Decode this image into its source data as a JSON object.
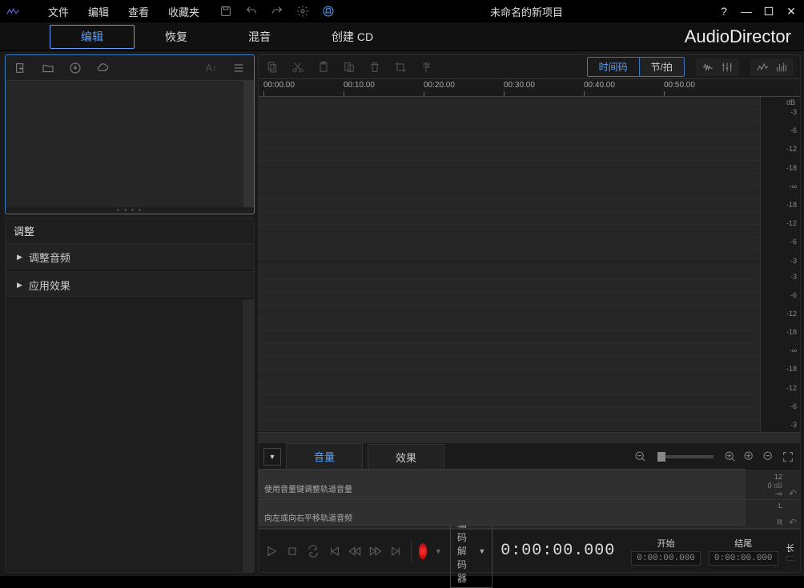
{
  "titlebar": {
    "menu": {
      "file": "文件",
      "edit": "编辑",
      "view": "查看",
      "favorites": "收藏夹"
    },
    "project_title": "未命名的新项目"
  },
  "brand": "AudioDirector",
  "mode_tabs": {
    "edit": "编辑",
    "restore": "恢复",
    "mix": "混音",
    "create_cd": "创建 CD"
  },
  "adjust": {
    "header": "调整",
    "item_audio": "调整音频",
    "item_effect": "应用效果"
  },
  "wave_toolbar": {
    "seg_timecode": "时间码",
    "seg_beat": "节/拍"
  },
  "ruler": [
    "00:00.00",
    "00:10.00",
    "00:20.00",
    "00:30.00",
    "00:40.00",
    "00:50.00"
  ],
  "db_unit": "dB",
  "db_ticks": [
    "-3",
    "-6",
    "-12",
    "-18",
    "-∞",
    "-18",
    "-12",
    "-6",
    "-3"
  ],
  "lower_tabs": {
    "volume": "音量",
    "effect": "效果"
  },
  "lane1": {
    "text": "使用音量键调整轨道音量",
    "scale": [
      "12",
      "0",
      "-∞"
    ],
    "unit": "dB"
  },
  "lane2": {
    "text": "向左或向右平移轨道音频",
    "scale_l": "L",
    "scale_r": "R"
  },
  "transport": {
    "encoder": "编码解码器",
    "main_time": "0:00:00.000",
    "start_label": "开始",
    "end_label": "结尾",
    "len_label": "长",
    "start_val": "0:00:00.000",
    "end_val": "0:00:00.000"
  }
}
